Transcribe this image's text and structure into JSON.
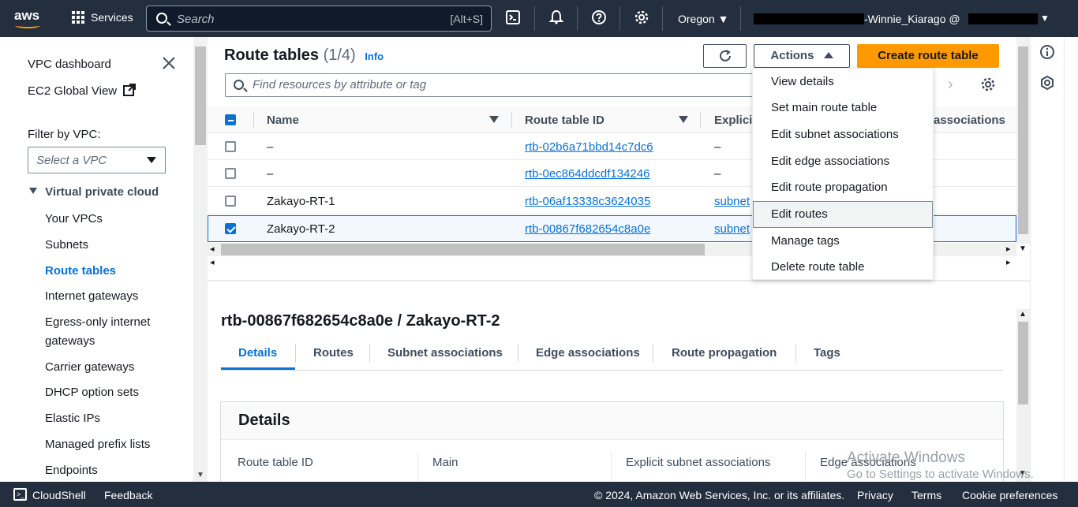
{
  "topnav": {
    "logo": "aws",
    "services_label": "Services",
    "search_placeholder": "Search",
    "search_shortcut": "[Alt+S]",
    "region": "Oregon ▼",
    "account": "-Winnie_Kiarago @",
    "icons": [
      "cloudshell-icon",
      "bell-icon",
      "help-icon",
      "settings-icon"
    ]
  },
  "sidenav": {
    "dashboard": "VPC dashboard",
    "global_view": "EC2 Global View",
    "filter_label": "Filter by VPC:",
    "filter_placeholder": "Select a VPC",
    "section": "Virtual private cloud",
    "items": [
      {
        "label": "Your VPCs",
        "active": false
      },
      {
        "label": "Subnets",
        "active": false
      },
      {
        "label": "Route tables",
        "active": true
      },
      {
        "label": "Internet gateways",
        "active": false
      },
      {
        "label": "Egress-only internet",
        "active": false
      },
      {
        "label": "gateways",
        "active": false
      },
      {
        "label": "Carrier gateways",
        "active": false
      },
      {
        "label": "DHCP option sets",
        "active": false
      },
      {
        "label": "Elastic IPs",
        "active": false
      },
      {
        "label": "Managed prefix lists",
        "active": false
      },
      {
        "label": "Endpoints",
        "active": false
      }
    ]
  },
  "header": {
    "title": "Route tables",
    "count": "(1/4)",
    "info": "Info",
    "actions_label": "Actions",
    "create_label": "Create route table",
    "filter_placeholder": "Find resources by attribute or tag"
  },
  "table": {
    "columns": [
      "Name",
      "Route table ID",
      "Explicit",
      "associations"
    ],
    "rows": [
      {
        "name": "–",
        "id": "rtb-02b6a71bbd14c7dc6",
        "explicit": "–",
        "checked": false
      },
      {
        "name": "–",
        "id": "rtb-0ec864ddcdf134246",
        "explicit": "–",
        "checked": false
      },
      {
        "name": "Zakayo-RT-1",
        "id": "rtb-06af13338c3624035",
        "explicit": "subnet",
        "checked": false
      },
      {
        "name": "Zakayo-RT-2",
        "id": "rtb-00867f682654c8a0e",
        "explicit": "subnet",
        "checked": true
      }
    ]
  },
  "actions_menu": [
    "View details",
    "Set main route table",
    "Edit subnet associations",
    "Edit edge associations",
    "Edit route propagation",
    "Edit routes",
    "Manage tags",
    "Delete route table"
  ],
  "details": {
    "heading": "rtb-00867f682654c8a0e / Zakayo-RT-2",
    "tabs": [
      "Details",
      "Routes",
      "Subnet associations",
      "Edge associations",
      "Route propagation",
      "Tags"
    ],
    "card_title": "Details",
    "fields": [
      "Route table ID",
      "Main",
      "Explicit subnet associations",
      "Edge associations"
    ]
  },
  "footer": {
    "cloudshell": "CloudShell",
    "feedback": "Feedback",
    "copyright": "© 2024, Amazon Web Services, Inc. or its affiliates.",
    "privacy": "Privacy",
    "terms": "Terms",
    "cookies": "Cookie preferences"
  },
  "watermark": {
    "line1": "Activate Windows",
    "line2": "Go to Settings to activate Windows."
  },
  "colors": {
    "nav_bg": "#232f3e",
    "accent": "#ff9900",
    "link": "#0972d3"
  }
}
